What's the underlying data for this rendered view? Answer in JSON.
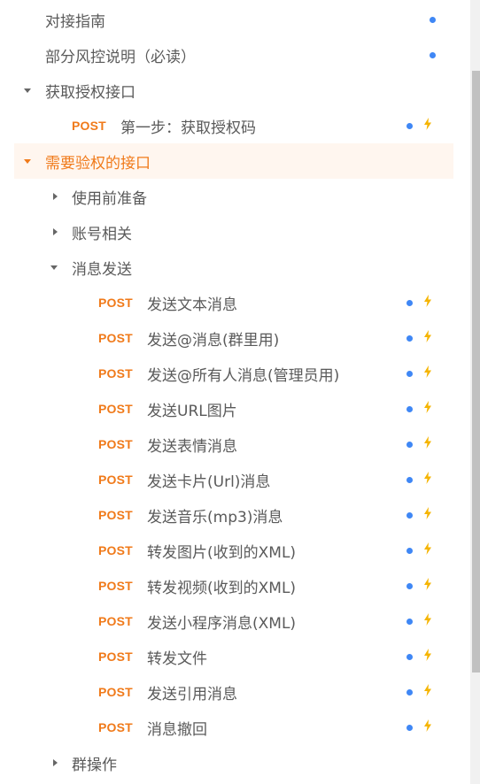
{
  "tree": {
    "items": [
      {
        "label": "对接指南"
      },
      {
        "label": "部分风控说明（必读）"
      },
      {
        "label": "获取授权接口"
      },
      {
        "method": "POST",
        "label": "第一步：获取授权码"
      },
      {
        "label": "需要验权的接口"
      },
      {
        "label": "使用前准备"
      },
      {
        "label": "账号相关"
      },
      {
        "label": "消息发送"
      },
      {
        "method": "POST",
        "label": "发送文本消息"
      },
      {
        "method": "POST",
        "label": "发送@消息(群里用)"
      },
      {
        "method": "POST",
        "label": "发送@所有人消息(管理员用)"
      },
      {
        "method": "POST",
        "label": "发送URL图片"
      },
      {
        "method": "POST",
        "label": "发送表情消息"
      },
      {
        "method": "POST",
        "label": "发送卡片(Url)消息"
      },
      {
        "method": "POST",
        "label": "发送音乐(mp3)消息"
      },
      {
        "method": "POST",
        "label": "转发图片(收到的XML)"
      },
      {
        "method": "POST",
        "label": "转发视频(收到的XML)"
      },
      {
        "method": "POST",
        "label": "发送小程序消息(XML)"
      },
      {
        "method": "POST",
        "label": "转发文件"
      },
      {
        "method": "POST",
        "label": "发送引用消息"
      },
      {
        "method": "POST",
        "label": "消息撤回"
      },
      {
        "label": "群操作"
      }
    ]
  },
  "colors": {
    "accent": "#f07a1a",
    "dot": "#3f87f5",
    "bolt": "#f5b400",
    "active_bg": "#fff6ef"
  }
}
